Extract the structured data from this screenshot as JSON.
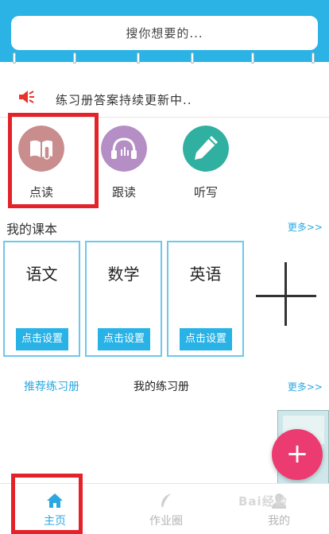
{
  "header": {
    "search_placeholder": "搜你想要的..."
  },
  "notice": {
    "text": "练习册答案持续更新中.."
  },
  "features": [
    {
      "label": "点读",
      "color": "#c98d8d"
    },
    {
      "label": "跟读",
      "color": "#b48ec4"
    },
    {
      "label": "听写",
      "color": "#2fb0a0"
    }
  ],
  "textbooks": {
    "title": "我的课本",
    "more": "更多>>",
    "cards": [
      {
        "subject": "语文",
        "button": "点击设置"
      },
      {
        "subject": "数学",
        "button": "点击设置"
      },
      {
        "subject": "英语",
        "button": "点击设置"
      }
    ]
  },
  "workbooks": {
    "tab_recommended": "推荐练习册",
    "tab_mine": "我的练习册",
    "more": "更多>>"
  },
  "fab": {
    "symbol": "+"
  },
  "bottom_nav": {
    "home": "主页",
    "circle": "作业圈",
    "mine": "我的"
  },
  "watermark": "Bai经验",
  "colors": {
    "header": "#2bb3e5",
    "accent": "#2ba8e0",
    "highlight_box": "#e4222a",
    "fab": "#ec3b70"
  }
}
